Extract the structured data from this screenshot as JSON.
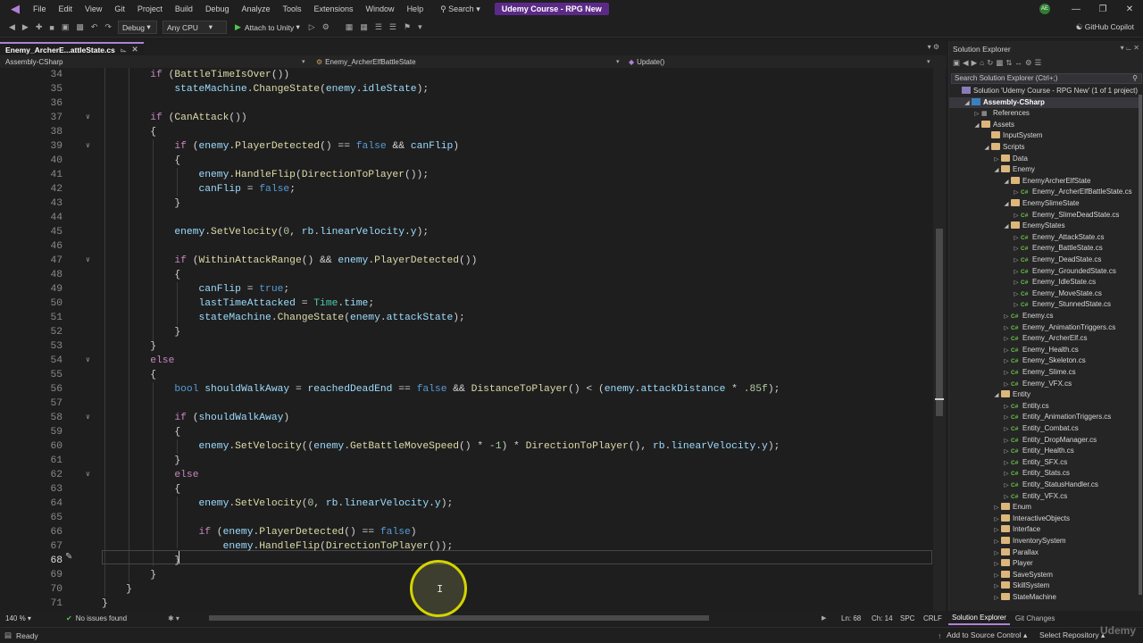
{
  "menu": [
    "File",
    "Edit",
    "View",
    "Git",
    "Project",
    "Build",
    "Debug",
    "Analyze",
    "Tools",
    "Extensions",
    "Window",
    "Help"
  ],
  "search_label": "Search",
  "project_title": "Udemy Course - RPG New",
  "avatar_initials": "AE",
  "toolbar": {
    "configuration": "Debug",
    "platform": "Any CPU",
    "attach_label": "Attach to Unity",
    "copilot_label": "GitHub Copilot"
  },
  "editor_tab": "Enemy_ArcherE...attleState.cs",
  "navbar": {
    "project": "Assembly-CSharp",
    "class": "Enemy_ArcherElfBattleState",
    "member": "Update()"
  },
  "code_lines": [
    {
      "ln": "34",
      "html": "        <span class=\"ct\">if</span> (<span class=\"fn\">BattleTimeIsOver</span>())"
    },
    {
      "ln": "35",
      "html": "            <span class=\"pm\">stateMachine</span>.<span class=\"fn\">ChangeState</span>(<span class=\"pm\">enemy</span>.<span class=\"pm\">idleState</span>);"
    },
    {
      "ln": "36",
      "html": ""
    },
    {
      "ln": "37",
      "html": "        <span class=\"ct\">if</span> (<span class=\"fn\">CanAttack</span>())",
      "fold": true
    },
    {
      "ln": "38",
      "html": "        {"
    },
    {
      "ln": "39",
      "html": "            <span class=\"ct\">if</span> (<span class=\"pm\">enemy</span>.<span class=\"fn\">PlayerDetected</span>() == <span class=\"kw\">false</span> &amp;&amp; <span class=\"pm\">canFlip</span>)",
      "fold": true
    },
    {
      "ln": "40",
      "html": "            {"
    },
    {
      "ln": "41",
      "html": "                <span class=\"pm\">enemy</span>.<span class=\"fn\">HandleFlip</span>(<span class=\"fn\">DirectionToPlayer</span>());"
    },
    {
      "ln": "42",
      "html": "                <span class=\"pm\">canFlip</span> = <span class=\"kw\">false</span>;"
    },
    {
      "ln": "43",
      "html": "            }"
    },
    {
      "ln": "44",
      "html": ""
    },
    {
      "ln": "45",
      "html": "            <span class=\"pm\">enemy</span>.<span class=\"fn\">SetVelocity</span>(<span class=\"nm\">0</span>, <span class=\"pm\">rb</span>.<span class=\"pm\">linearVelocity</span>.<span class=\"pm\">y</span>);"
    },
    {
      "ln": "46",
      "html": ""
    },
    {
      "ln": "47",
      "html": "            <span class=\"ct\">if</span> (<span class=\"fn\">WithinAttackRange</span>() &amp;&amp; <span class=\"pm\">enemy</span>.<span class=\"fn\">PlayerDetected</span>())",
      "fold": true
    },
    {
      "ln": "48",
      "html": "            {"
    },
    {
      "ln": "49",
      "html": "                <span class=\"pm\">canFlip</span> = <span class=\"kw\">true</span>;"
    },
    {
      "ln": "50",
      "html": "                <span class=\"pm\">lastTimeAttacked</span> = <span class=\"ty\">Time</span>.<span class=\"pm\">time</span>;"
    },
    {
      "ln": "51",
      "html": "                <span class=\"pm\">stateMachine</span>.<span class=\"fn\">ChangeState</span>(<span class=\"pm\">enemy</span>.<span class=\"pm\">attackState</span>);"
    },
    {
      "ln": "52",
      "html": "            }"
    },
    {
      "ln": "53",
      "html": "        }"
    },
    {
      "ln": "54",
      "html": "        <span class=\"ct\">else</span>",
      "fold": true
    },
    {
      "ln": "55",
      "html": "        {"
    },
    {
      "ln": "56",
      "html": "            <span class=\"kw\">bool</span> <span class=\"pm\">shouldWalkAway</span> = <span class=\"pm\">reachedDeadEnd</span> == <span class=\"kw\">false</span> &amp;&amp; <span class=\"fn\">DistanceToPlayer</span>() &lt; (<span class=\"pm\">enemy</span>.<span class=\"pm\">attackDistance</span> * <span class=\"nm\">.85f</span>);"
    },
    {
      "ln": "57",
      "html": ""
    },
    {
      "ln": "58",
      "html": "            <span class=\"ct\">if</span> (<span class=\"pm\">shouldWalkAway</span>)",
      "fold": true
    },
    {
      "ln": "59",
      "html": "            {"
    },
    {
      "ln": "60",
      "html": "                <span class=\"pm\">enemy</span>.<span class=\"fn\">SetVelocity</span>((<span class=\"pm\">enemy</span>.<span class=\"fn\">GetBattleMoveSpeed</span>() * <span class=\"nm\">-1</span>) * <span class=\"fn\">DirectionToPlayer</span>(), <span class=\"pm\">rb</span>.<span class=\"pm\">linearVelocity</span>.<span class=\"pm\">y</span>);"
    },
    {
      "ln": "61",
      "html": "            }"
    },
    {
      "ln": "62",
      "html": "            <span class=\"ct\">else</span>",
      "fold": true
    },
    {
      "ln": "63",
      "html": "            {"
    },
    {
      "ln": "64",
      "html": "                <span class=\"pm\">enemy</span>.<span class=\"fn\">SetVelocity</span>(<span class=\"nm\">0</span>, <span class=\"pm\">rb</span>.<span class=\"pm\">linearVelocity</span>.<span class=\"pm\">y</span>);"
    },
    {
      "ln": "65",
      "html": ""
    },
    {
      "ln": "66",
      "html": "                <span class=\"ct\">if</span> (<span class=\"pm\">enemy</span>.<span class=\"fn\">PlayerDetected</span>() == <span class=\"kw\">false</span>)"
    },
    {
      "ln": "67",
      "html": "                    <span class=\"pm\">enemy</span>.<span class=\"fn\">HandleFlip</span>(<span class=\"fn\">DirectionToPlayer</span>());"
    },
    {
      "ln": "68",
      "html": "            }",
      "current": true
    },
    {
      "ln": "69",
      "html": "        }"
    },
    {
      "ln": "70",
      "html": "    }"
    },
    {
      "ln": "71",
      "html": "}"
    }
  ],
  "editor_status": {
    "zoom": "140 %",
    "issues": "No issues found",
    "line": "Ln: 68",
    "char": "Ch: 14",
    "spc": "SPC",
    "crlf": "CRLF"
  },
  "statusbar": {
    "ready": "Ready",
    "add_source": "Add to Source Control",
    "select_repo": "Select Repository"
  },
  "solution_explorer": {
    "title": "Solution Explorer",
    "search_placeholder": "Search Solution Explorer (Ctrl+;)",
    "tabs": [
      "Solution Explorer",
      "Git Changes"
    ],
    "tree": [
      {
        "label": "Solution 'Udemy Course - RPG New' (1 of 1 project)",
        "depth": 0,
        "icon": "sln",
        "tw": ""
      },
      {
        "label": "Assembly-CSharp",
        "depth": 1,
        "icon": "proj",
        "tw": "open",
        "selected": true
      },
      {
        "label": "References",
        "depth": 2,
        "icon": "ref",
        "tw": "closed"
      },
      {
        "label": "Assets",
        "depth": 2,
        "icon": "folder",
        "tw": "open"
      },
      {
        "label": "InputSystem",
        "depth": 3,
        "icon": "folder",
        "tw": ""
      },
      {
        "label": "Scripts",
        "depth": 3,
        "icon": "folder",
        "tw": "open"
      },
      {
        "label": "Data",
        "depth": 4,
        "icon": "folder",
        "tw": "closed"
      },
      {
        "label": "Enemy",
        "depth": 4,
        "icon": "folder",
        "tw": "open"
      },
      {
        "label": "EnemyArcherElfState",
        "depth": 5,
        "icon": "folder",
        "tw": "open"
      },
      {
        "label": "Enemy_ArcherElfBattleState.cs",
        "depth": 6,
        "icon": "cs",
        "tw": "closed"
      },
      {
        "label": "EnemySlimeState",
        "depth": 5,
        "icon": "folder",
        "tw": "open"
      },
      {
        "label": "Enemy_SlimeDeadState.cs",
        "depth": 6,
        "icon": "cs",
        "tw": "closed"
      },
      {
        "label": "EnemyStates",
        "depth": 5,
        "icon": "folder",
        "tw": "open"
      },
      {
        "label": "Enemy_AttackState.cs",
        "depth": 6,
        "icon": "cs",
        "tw": "closed"
      },
      {
        "label": "Enemy_BattleState.cs",
        "depth": 6,
        "icon": "cs",
        "tw": "closed"
      },
      {
        "label": "Enemy_DeadState.cs",
        "depth": 6,
        "icon": "cs",
        "tw": "closed"
      },
      {
        "label": "Enemy_GroundedState.cs",
        "depth": 6,
        "icon": "cs",
        "tw": "closed"
      },
      {
        "label": "Enemy_IdleState.cs",
        "depth": 6,
        "icon": "cs",
        "tw": "closed"
      },
      {
        "label": "Enemy_MoveState.cs",
        "depth": 6,
        "icon": "cs",
        "tw": "closed"
      },
      {
        "label": "Enemy_StunnedState.cs",
        "depth": 6,
        "icon": "cs",
        "tw": "closed"
      },
      {
        "label": "Enemy.cs",
        "depth": 5,
        "icon": "cs",
        "tw": "closed"
      },
      {
        "label": "Enemy_AnimationTriggers.cs",
        "depth": 5,
        "icon": "cs",
        "tw": "closed"
      },
      {
        "label": "Enemy_ArcherElf.cs",
        "depth": 5,
        "icon": "cs",
        "tw": "closed"
      },
      {
        "label": "Enemy_Health.cs",
        "depth": 5,
        "icon": "cs",
        "tw": "closed"
      },
      {
        "label": "Enemy_Skeleton.cs",
        "depth": 5,
        "icon": "cs",
        "tw": "closed"
      },
      {
        "label": "Enemy_Slime.cs",
        "depth": 5,
        "icon": "cs",
        "tw": "closed"
      },
      {
        "label": "Enemy_VFX.cs",
        "depth": 5,
        "icon": "cs",
        "tw": "closed"
      },
      {
        "label": "Entity",
        "depth": 4,
        "icon": "folder",
        "tw": "open"
      },
      {
        "label": "Entity.cs",
        "depth": 5,
        "icon": "cs",
        "tw": "closed"
      },
      {
        "label": "Entity_AnimationTriggers.cs",
        "depth": 5,
        "icon": "cs",
        "tw": "closed"
      },
      {
        "label": "Entity_Combat.cs",
        "depth": 5,
        "icon": "cs",
        "tw": "closed"
      },
      {
        "label": "Entity_DropManager.cs",
        "depth": 5,
        "icon": "cs",
        "tw": "closed"
      },
      {
        "label": "Entity_Health.cs",
        "depth": 5,
        "icon": "cs",
        "tw": "closed"
      },
      {
        "label": "Entity_SFX.cs",
        "depth": 5,
        "icon": "cs",
        "tw": "closed"
      },
      {
        "label": "Entity_Stats.cs",
        "depth": 5,
        "icon": "cs",
        "tw": "closed"
      },
      {
        "label": "Entity_StatusHandler.cs",
        "depth": 5,
        "icon": "cs",
        "tw": "closed"
      },
      {
        "label": "Entity_VFX.cs",
        "depth": 5,
        "icon": "cs",
        "tw": "closed"
      },
      {
        "label": "Enum",
        "depth": 4,
        "icon": "folder",
        "tw": "closed"
      },
      {
        "label": "InteractiveObjects",
        "depth": 4,
        "icon": "folder",
        "tw": "closed"
      },
      {
        "label": "Interface",
        "depth": 4,
        "icon": "folder",
        "tw": "closed"
      },
      {
        "label": "InventorySystem",
        "depth": 4,
        "icon": "folder",
        "tw": "closed"
      },
      {
        "label": "Parallax",
        "depth": 4,
        "icon": "folder",
        "tw": "closed"
      },
      {
        "label": "Player",
        "depth": 4,
        "icon": "folder",
        "tw": "closed"
      },
      {
        "label": "SaveSystem",
        "depth": 4,
        "icon": "folder",
        "tw": "closed"
      },
      {
        "label": "SkillSystem",
        "depth": 4,
        "icon": "folder",
        "tw": "closed"
      },
      {
        "label": "StateMachine",
        "depth": 4,
        "icon": "folder",
        "tw": "closed"
      }
    ]
  },
  "watermark": "Udemy",
  "colors": {
    "accent": "#b180d7",
    "project_badge": "#5b2a86",
    "editor_bg": "#1e1e1e",
    "cursor_ring": "#d4d400"
  }
}
